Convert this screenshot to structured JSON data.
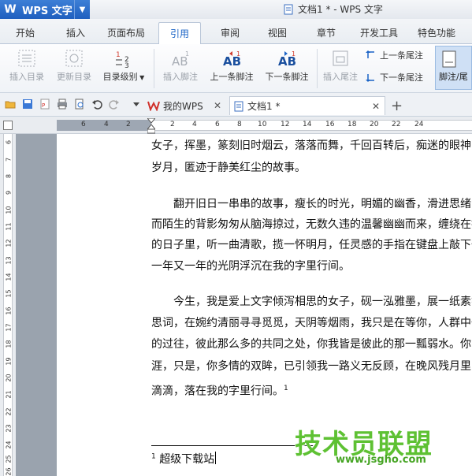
{
  "titlebar": {
    "app_name": "WPS 文字",
    "doc_title": "文档1 * - WPS 文字"
  },
  "menu": {
    "tabs": [
      "开始",
      "插入",
      "页面布局",
      "引用",
      "审阅",
      "视图",
      "章节",
      "开发工具",
      "特色功能"
    ],
    "active": "引用"
  },
  "ribbon": {
    "insert_toc": "插入目录",
    "update_toc": "更新目录",
    "toc_level": "目录级别",
    "insert_footnote": "插入脚注",
    "prev_footnote": "上一条脚注",
    "next_footnote": "下一条脚注",
    "insert_endnote": "插入尾注",
    "prev_endnote": "上一条尾注",
    "next_endnote": "下一条尾注",
    "footnote_endnote": "脚注/尾"
  },
  "doctabs": {
    "mywps": "我的WPS",
    "doc1": "文档1 *"
  },
  "ruler": {
    "h_numbers": [
      "6",
      "4",
      "2",
      "2",
      "4",
      "6",
      "8",
      "10",
      "12",
      "14",
      "16",
      "18",
      "20",
      "22",
      "24"
    ],
    "v_numbers": [
      "6",
      "7",
      "8",
      "9",
      "10",
      "11",
      "12",
      "13",
      "14",
      "15",
      "16",
      "17",
      "18",
      "19",
      "20",
      "21",
      "22",
      "23",
      "24",
      "25",
      "26"
    ]
  },
  "document": {
    "lines": [
      "女子，挥墨，篆刻旧时烟云，落落而舞，千回百转后，痴迷的眼神，",
      "岁月，匿迹于静美红尘的故事。",
      "",
      "　　翻开旧日一串串的故事，瘦长的时光，明媚的幽香，滑进思绪中",
      "而陌生的背影匆匆从脑海掠过，无数久违的温馨幽幽而来，缠绕在指",
      "的日子里，听一曲清歌，揽一怀明月，任灵感的手指在键盘上敲下一",
      "一年又一年的光阴浮沉在我的字里行间。",
      "",
      "　　今生，我是爱上文字倾泻相思的女子，砚一泓雅墨，展一纸素笺",
      "思词，在婉约清丽寻寻觅觅，天阴等烟雨，我只是在等你，人群中一",
      "的过往，彼此那么多的共同之处，你我皆是彼此的那一瓢弱水。你已",
      "涯，只是，你多情的双眸，已引领我一路义无反顾，在晚风残月里，",
      "滴滴，落在我的字里行间。"
    ],
    "footnote_mark": "1",
    "footnote_text": "超级下载站"
  },
  "watermark": {
    "text": "技术员联盟",
    "url": "www.jsgho.com"
  },
  "colors": {
    "accent": "#1a63c6",
    "wps_blue": "#2a6fcf",
    "watermark_green": "#5ec133"
  }
}
